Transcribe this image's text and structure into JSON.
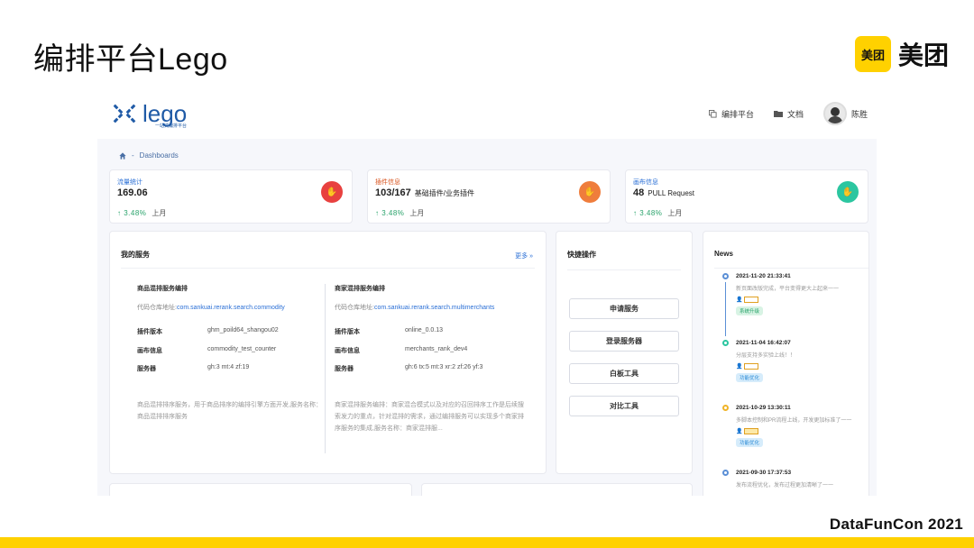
{
  "slide": {
    "title": "编排平台Lego",
    "brand_logo": "美团",
    "brand_text": "美团",
    "footer": "DataFunCon 2021",
    "accent_color": "#FFD100"
  },
  "app": {
    "logo_text": "lego",
    "logo_sub": "一站式编排平台",
    "nav": [
      {
        "label": "编排平台",
        "icon": "copy-icon"
      },
      {
        "label": "文档",
        "icon": "folder-icon"
      }
    ],
    "user_name": "陈胜",
    "breadcrumb": {
      "home_icon": "home-icon",
      "separator": "-",
      "current": "Dashboards"
    },
    "stats": [
      {
        "label": "流量统计",
        "value": "169.06",
        "value_sub": "",
        "growth": "3.48%",
        "unit": "上月",
        "badge_icon": "hand-icon",
        "color": "#e8413f"
      },
      {
        "label": "插件信息",
        "value": "103/167",
        "value_sub": "基础插件/业务插件",
        "growth": "3.48%",
        "unit": "上月",
        "badge_icon": "hand-icon",
        "color": "#ef7d3c"
      },
      {
        "label": "画布信息",
        "value": "48",
        "value_sub": "PULL Request",
        "growth": "3.48%",
        "unit": "上月",
        "badge_icon": "hand-icon",
        "color": "#2cc6a0"
      }
    ],
    "growth_arrow": "↑",
    "services": {
      "title": "我的服务",
      "more": "更多 »",
      "items": [
        {
          "name": "商品混排服务编排",
          "repo_label": "代码仓库地址:",
          "repo": "com.sankuai.rerank.search.commodity",
          "kv": [
            {
              "k": "插件版本",
              "v": "ghm_poild64_shangou02"
            },
            {
              "k": "画布信息",
              "v": "commodity_test_counter"
            },
            {
              "k": "服务器",
              "v": "gh:3 mt:4 zf:19"
            }
          ],
          "desc": "商品混排排序服务，用于商品排序的编排引擎方面开发,服务名称：商品混排排序服务"
        },
        {
          "name": "商家混排服务编排",
          "repo_label": "代码仓库地址:",
          "repo": "com.sankuai.rerank.search.multimerchants",
          "kv": [
            {
              "k": "插件版本",
              "v": "online_0.0.13"
            },
            {
              "k": "画布信息",
              "v": "merchants_rank_dev4"
            },
            {
              "k": "服务器",
              "v": "gh:6 tx:5 mt:3 xr:2 zf:26 yf:3"
            }
          ],
          "desc": "商家混排服务编排：商家混合模式以及对应的召回排序工作是后续搜索发力的重点，针对混排的需求，通过编排服务可以实现多个商家排序服务的集成,服务名称：商家混排服..."
        }
      ]
    },
    "quick": {
      "title": "快捷操作",
      "buttons": [
        "申请服务",
        "登录服务器",
        "白板工具",
        "对比工具"
      ]
    },
    "news": {
      "title": "News",
      "items": [
        {
          "time": "2021-11-20 21:33:41",
          "text": "新页面改版完成，平台变得更大上起来一一",
          "tag": "系统升级",
          "tag_color": "#2aa36b",
          "tag_bg": "#d8f3e4",
          "dot": "#5b8fd6"
        },
        {
          "time": "2021-11-04 16:42:07",
          "text": "分层支持多实验上线！！",
          "tag": "功能优化",
          "tag_color": "#2a8ad6",
          "tag_bg": "#d6ecfb",
          "dot": "#2cc6a0"
        },
        {
          "time": "2021-10-29 13:30:11",
          "text": "多脚本控制和PR流程上线，开发更加标准了一一",
          "tag": "功能优化",
          "tag_color": "#2a8ad6",
          "tag_bg": "#d6ecfb",
          "dot": "#f0b428"
        },
        {
          "time": "2021-09-30 17:37:53",
          "text": "发布流程优化，发布过程更加清晰了一一",
          "tag": "",
          "tag_color": "#2a8ad6",
          "tag_bg": "#d6ecfb",
          "dot": "#5b8fd6"
        }
      ]
    }
  }
}
